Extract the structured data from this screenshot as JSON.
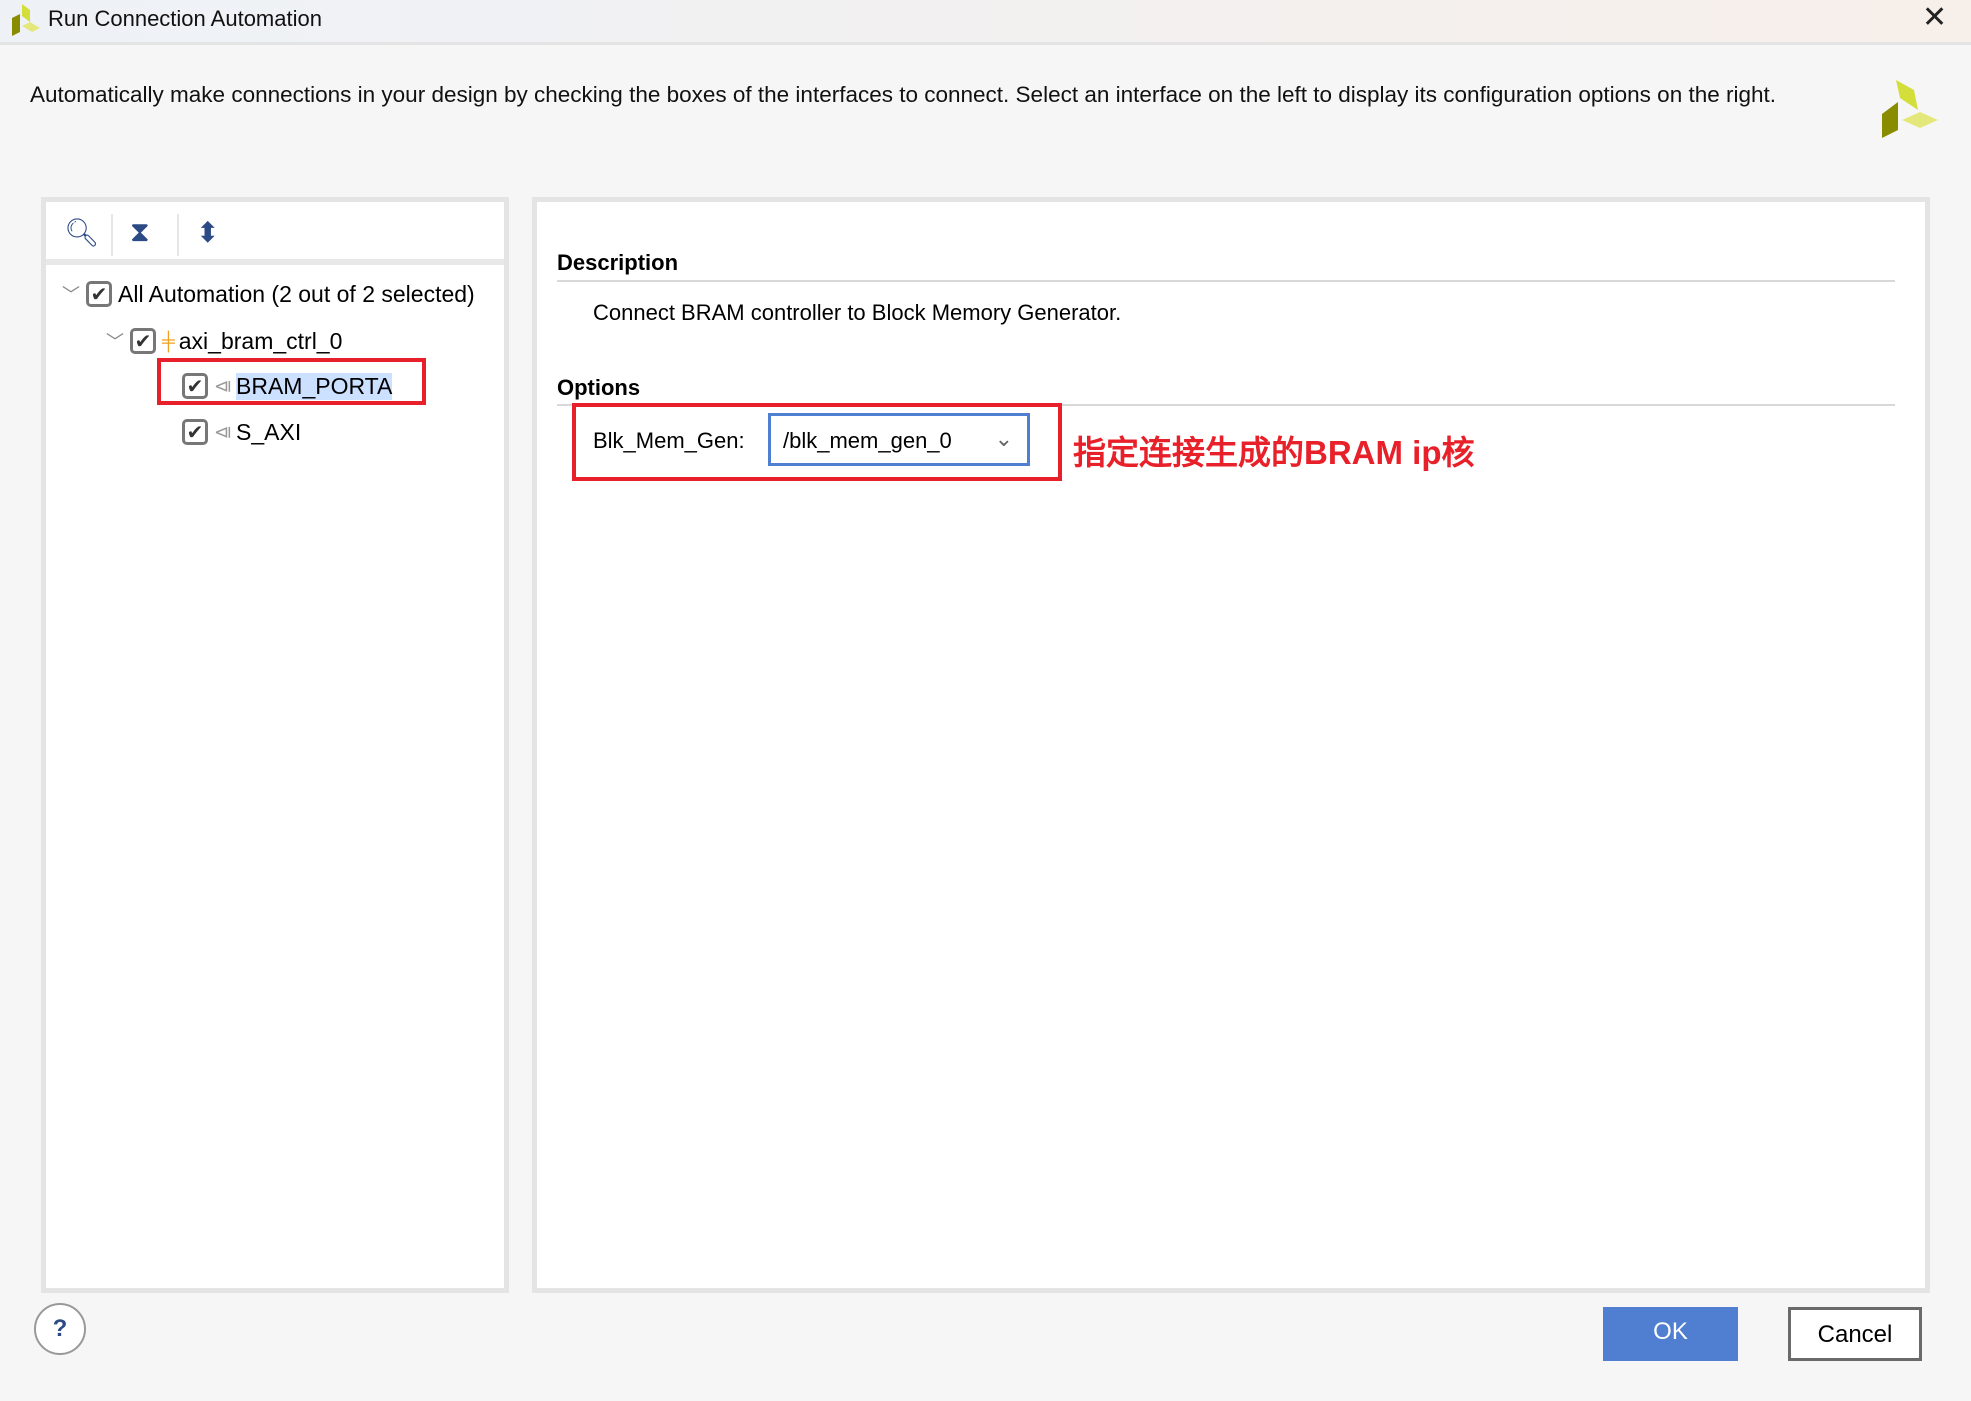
{
  "window": {
    "title": "Run Connection Automation",
    "close_label": "✕"
  },
  "description_text": "Automatically make connections in your design by checking the boxes of the interfaces to connect. Select an interface on the left to display its configuration options on the right.",
  "tree": {
    "root": {
      "label": "All Automation (2 out of 2 selected)",
      "checked": true
    },
    "items": [
      {
        "label": "axi_bram_ctrl_0",
        "checked": true
      },
      {
        "label": "BRAM_PORTA",
        "checked": true,
        "selected": true
      },
      {
        "label": "S_AXI",
        "checked": true
      }
    ]
  },
  "details": {
    "description_header": "Description",
    "description_body": "Connect BRAM controller to Block Memory Generator.",
    "options_header": "Options",
    "option_label": "Blk_Mem_Gen:",
    "option_value": "/blk_mem_gen_0"
  },
  "annotation": "指定连接生成的BRAM ip核",
  "buttons": {
    "help": "?",
    "ok": "OK",
    "cancel": "Cancel"
  },
  "colors": {
    "accent": "#507fd2",
    "annotation": "#e8202a",
    "selection": "#cce0ff"
  }
}
